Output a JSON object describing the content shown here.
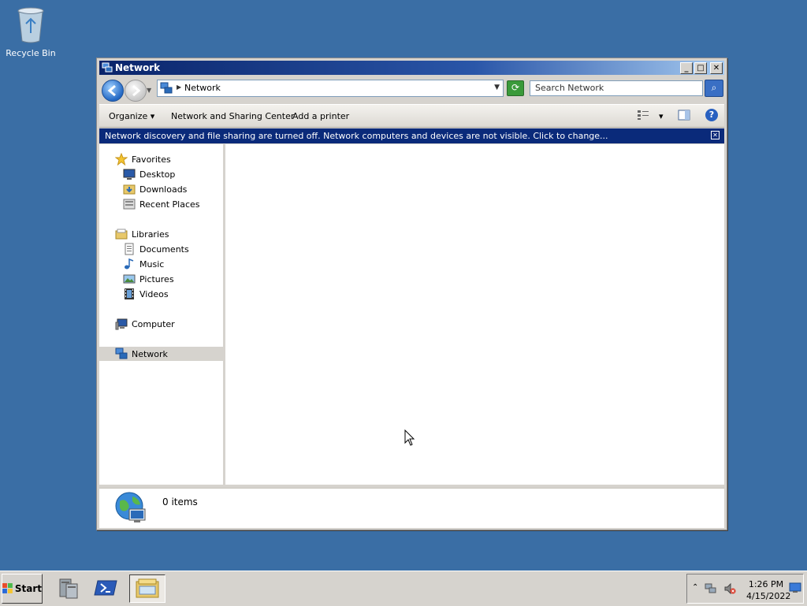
{
  "desktop": {
    "recycle_bin_label": "Recycle Bin",
    "background_color": "#3a6ea5"
  },
  "window": {
    "title": "Network",
    "address": {
      "breadcrumb": "Network",
      "search_placeholder": "Search Network"
    },
    "toolbar": {
      "organize": "Organize",
      "network_sharing": "Network and Sharing Center",
      "add_printer": "Add a printer"
    },
    "infobar": {
      "message": "Network discovery and file sharing are turned off. Network computers and devices are not visible. Click to change..."
    },
    "nav": {
      "favorites": "Favorites",
      "desktop": "Desktop",
      "downloads": "Downloads",
      "recent_places": "Recent Places",
      "libraries": "Libraries",
      "documents": "Documents",
      "music": "Music",
      "pictures": "Pictures",
      "videos": "Videos",
      "computer": "Computer",
      "network": "Network"
    },
    "details": {
      "items_count": "0 items"
    }
  },
  "taskbar": {
    "start_label": "Start",
    "clock": {
      "time": "1:26 PM",
      "date": "4/15/2022"
    }
  },
  "icons": [
    "recycle-bin-icon",
    "network-icon",
    "back-icon",
    "forward-icon",
    "refresh-icon",
    "search-icon",
    "views-icon",
    "preview-pane-icon",
    "help-icon",
    "star-icon",
    "desktop-icon",
    "downloads-icon",
    "recent-places-icon",
    "libraries-icon",
    "documents-icon",
    "music-icon",
    "pictures-icon",
    "videos-icon",
    "computer-icon",
    "globe-icon",
    "server-manager-icon",
    "powershell-icon",
    "explorer-icon",
    "volume-muted-icon",
    "show-desktop-icon"
  ]
}
